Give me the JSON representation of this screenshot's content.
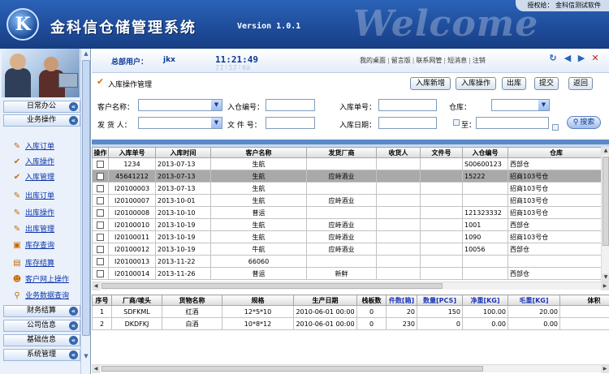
{
  "banner": {
    "logo_letter": "K",
    "title": "金科信仓储管理系统",
    "version": "Version 1.0.1",
    "welcome": "Welcome",
    "licensed_label": "授权给：",
    "licensed_to": "金科信测试软件"
  },
  "sidebar": {
    "categories": [
      "日常办公",
      "业务操作",
      "财务结算",
      "公司信息",
      "基础信息",
      "系统管理"
    ],
    "items": [
      "入库订单",
      "入库操作",
      "入库管理",
      "出库订单",
      "出库操作",
      "出库管理",
      "库存查询",
      "库存结算",
      "客户网上操作",
      "业务数据查询"
    ]
  },
  "infobar": {
    "user_label": "总部用户：",
    "user_name": "jkx",
    "clock": "11:21:49",
    "links": [
      "我的桌面",
      "留言版",
      "联系网管",
      "短消息",
      "注销"
    ]
  },
  "page": {
    "title": "入库操作管理",
    "buttons": [
      "入库新增",
      "入库操作",
      "出库",
      "提交",
      "返回"
    ]
  },
  "filter": {
    "customer_label": "客户名称：",
    "entry_no_label": "入仓编号：",
    "order_no_label": "入库单号：",
    "warehouse_label": "仓库：",
    "consignor_label": "发 货 人：",
    "doc_no_label": "文 件 号：",
    "date_label": "入库日期：",
    "to_label": "至：",
    "search": "搜索"
  },
  "orders": {
    "columns": [
      "操作",
      "入库单号",
      "入库时间",
      "客户名称",
      "发货厂商",
      "收货人",
      "文件号",
      "入仓编号",
      "仓库"
    ],
    "rows": [
      [
        "",
        "1234",
        "2013-07-13",
        "生航",
        "",
        "",
        "",
        "S00600123",
        "西部仓"
      ],
      [
        "",
        "45641212",
        "2013-07-13",
        "生航",
        "应峙酒业",
        "",
        "",
        "15222",
        "招商103号仓"
      ],
      [
        "",
        "I20100003",
        "2013-07-13",
        "生航",
        "",
        "",
        "",
        "",
        "招商103号仓"
      ],
      [
        "",
        "I20100007",
        "2013-10-01",
        "生航",
        "应峙酒业",
        "",
        "",
        "",
        "招商103号仓"
      ],
      [
        "",
        "I20100008",
        "2013-10-10",
        "普运",
        "",
        "",
        "",
        "121323332",
        "招商103号仓"
      ],
      [
        "",
        "I20100010",
        "2013-10-19",
        "生航",
        "应峙酒业",
        "",
        "",
        "1001",
        "西部仓"
      ],
      [
        "",
        "I20100011",
        "2013-10-19",
        "生航",
        "应峙酒业",
        "",
        "",
        "1090",
        "招商103号仓"
      ],
      [
        "",
        "I20100012",
        "2013-10-19",
        "牛航",
        "应峙酒业",
        "",
        "",
        "10056",
        "西部仓"
      ],
      [
        "",
        "I20100013",
        "2013-11-22",
        "66060",
        "",
        "",
        "",
        "",
        ""
      ],
      [
        "",
        "I20100014",
        "2013-11-26",
        "普运",
        "新鲜",
        "",
        "",
        "",
        "西部仓"
      ]
    ]
  },
  "details": {
    "columns": [
      "序号",
      "厂商/唛头",
      "货物名称",
      "规格",
      "生产日期",
      "栈板数",
      "件数[箱]",
      "数量[PCS]",
      "净重[KG]",
      "毛重[KG]",
      "体积"
    ],
    "rows": [
      [
        "1",
        "SDFKML",
        "红酒",
        "12*5*10",
        "2010-06-01 00:00",
        "0",
        "20",
        "150",
        "100.00",
        "20.00",
        ""
      ],
      [
        "2",
        "DKDFKJ",
        "白酒",
        "10*8*12",
        "2010-06-01 00:00",
        "0",
        "230",
        "0",
        "0.00",
        "0.00",
        ""
      ]
    ]
  }
}
